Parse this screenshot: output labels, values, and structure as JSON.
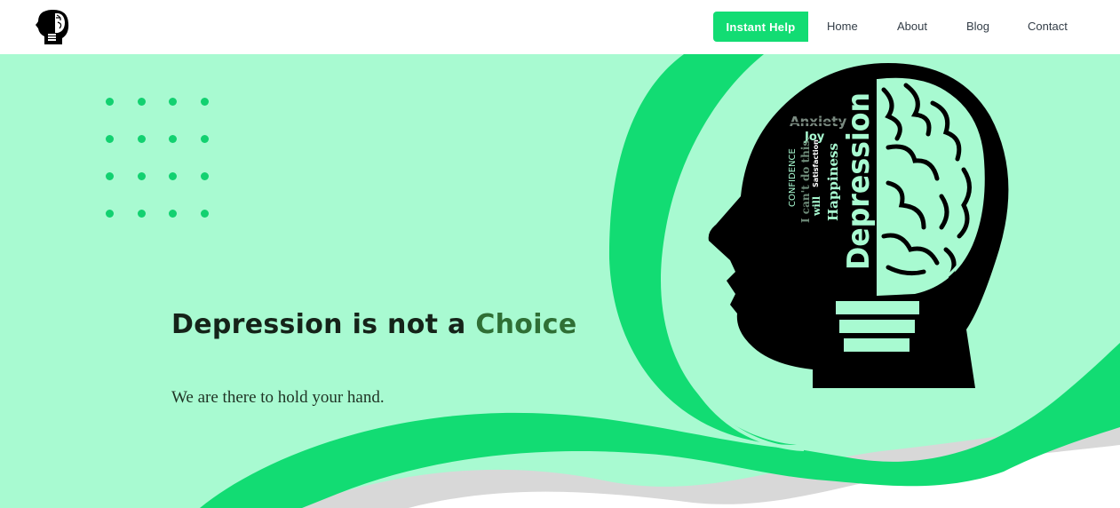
{
  "nav": {
    "logo_icon": "head-brain-logo-icon",
    "instant_help": "Instant Help",
    "links": [
      "Home",
      "About",
      "Blog",
      "Contact"
    ]
  },
  "hero": {
    "headline_main": "Depression is not a ",
    "headline_accent": "Choice",
    "tagline": "We are there to hold your hand.",
    "illustration_icon": "head-brain-illustration",
    "illustration_words": [
      "Anxiety",
      "Joy",
      "CONFIDENCE",
      "I can't do this.",
      "Happiness",
      "Satisfaction",
      "will",
      "Depression"
    ]
  },
  "colors": {
    "accent": "#12dc73",
    "hero_bg": "#a8fad1",
    "headline": "#152319",
    "headline_accent": "#2f6f35",
    "wave_gray": "#d8d8d8"
  }
}
